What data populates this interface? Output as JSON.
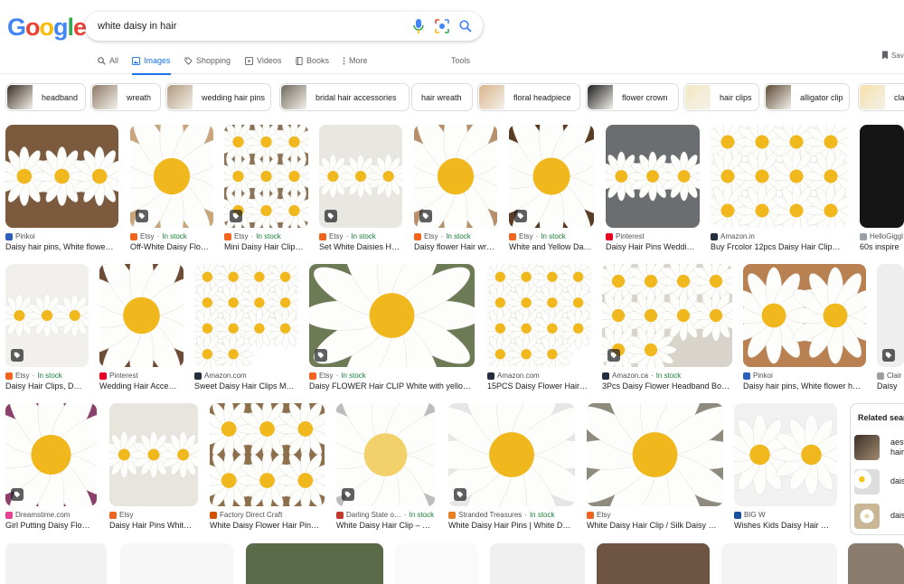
{
  "logo": {
    "letters": [
      "G",
      "o",
      "o",
      "g",
      "l",
      "e"
    ],
    "colors": [
      "#4285f4",
      "#ea4335",
      "#fbbc05",
      "#4285f4",
      "#34a853",
      "#ea4335"
    ]
  },
  "search": {
    "query": "white daisy in hair",
    "icons": [
      "microphone-icon",
      "lens-icon",
      "search-icon"
    ]
  },
  "nav": {
    "tabs": [
      {
        "label": "All",
        "icon": "search-icon",
        "active": false
      },
      {
        "label": "Images",
        "icon": "image-icon",
        "active": true
      },
      {
        "label": "Shopping",
        "icon": "tag-icon",
        "active": false
      },
      {
        "label": "Videos",
        "icon": "play-icon",
        "active": false
      },
      {
        "label": "Books",
        "icon": "book-icon",
        "active": false
      },
      {
        "label": "More",
        "icon": "kebab-icon",
        "active": false
      }
    ],
    "tools": "Tools",
    "save": "Sav"
  },
  "chips": [
    "headband",
    "wreath",
    "wedding hair pins",
    "bridal hair accessories",
    "hair wreath",
    "floral headpiece",
    "flower crown",
    "hair clips",
    "alligator clip",
    "cla"
  ],
  "results": [
    {
      "source": "Pinkoi",
      "stock": "",
      "title": "Daisy hair pins, White flowe…"
    },
    {
      "source": "Etsy",
      "stock": "In stock",
      "title": "Off-White Daisy Flo…"
    },
    {
      "source": "Etsy",
      "stock": "In stock",
      "title": "Mini Daisy Hair Clip…"
    },
    {
      "source": "Etsy",
      "stock": "In stock",
      "title": "Set White Daisies H…"
    },
    {
      "source": "Etsy",
      "stock": "In stock",
      "title": "Daisy flower Hair wr…"
    },
    {
      "source": "Etsy",
      "stock": "In stock",
      "title": "White and Yellow Da…"
    },
    {
      "source": "Pinterest",
      "stock": "",
      "title": "Daisy Hair Pins Weddi…"
    },
    {
      "source": "Amazon.in",
      "stock": "",
      "title": "Buy Frcolor 12pcs Daisy Hair Clip…"
    },
    {
      "source": "HelloGiggl",
      "stock": "",
      "title": "60s inspire"
    },
    {
      "source": "Etsy",
      "stock": "In stock",
      "title": "Daisy Hair Clips, D…"
    },
    {
      "source": "Pinterest",
      "stock": "",
      "title": "Wedding Hair Acce…"
    },
    {
      "source": "Amazon.com",
      "stock": "",
      "title": "Sweet Daisy Hair Clips M…"
    },
    {
      "source": "Etsy",
      "stock": "In stock",
      "title": "Daisy FLOWER Hair CLIP White with yello…"
    },
    {
      "source": "Amazon.com",
      "stock": "",
      "title": "15PCS Daisy Flower Hair…"
    },
    {
      "source": "Amazon.ca",
      "stock": "In stock",
      "title": "3Pcs Daisy Flower Headband Bo…"
    },
    {
      "source": "Pinkoi",
      "stock": "",
      "title": "Daisy hair pins, White flower h…"
    },
    {
      "source": "Clair",
      "stock": "",
      "title": "Daisy"
    },
    {
      "source": "Dreamstime.com",
      "stock": "",
      "title": "Girl Putting Daisy Flo…"
    },
    {
      "source": "Etsy",
      "stock": "",
      "title": "Daisy Hair Pins Whit…"
    },
    {
      "source": "Factory Direct Craft",
      "stock": "",
      "title": "White Daisy Flower Hair Pin…"
    },
    {
      "source": "Darling State o…",
      "stock": "In stock",
      "title": "White Daisy Hair Clip – …"
    },
    {
      "source": "Stranded Treasures",
      "stock": "In stock",
      "title": "White Daisy Hair Pins | White D…"
    },
    {
      "source": "Etsy",
      "stock": "",
      "title": "White Daisy Hair Clip / Silk Daisy …"
    },
    {
      "source": "BIG W",
      "stock": "",
      "title": "Wishes Kids Daisy Hair …"
    }
  ],
  "related": {
    "heading": "Related searc",
    "items": [
      "aesth hair",
      "daisy",
      "daisy"
    ]
  },
  "colors": {
    "accent": "#1a73e8",
    "stock": "#188038"
  }
}
